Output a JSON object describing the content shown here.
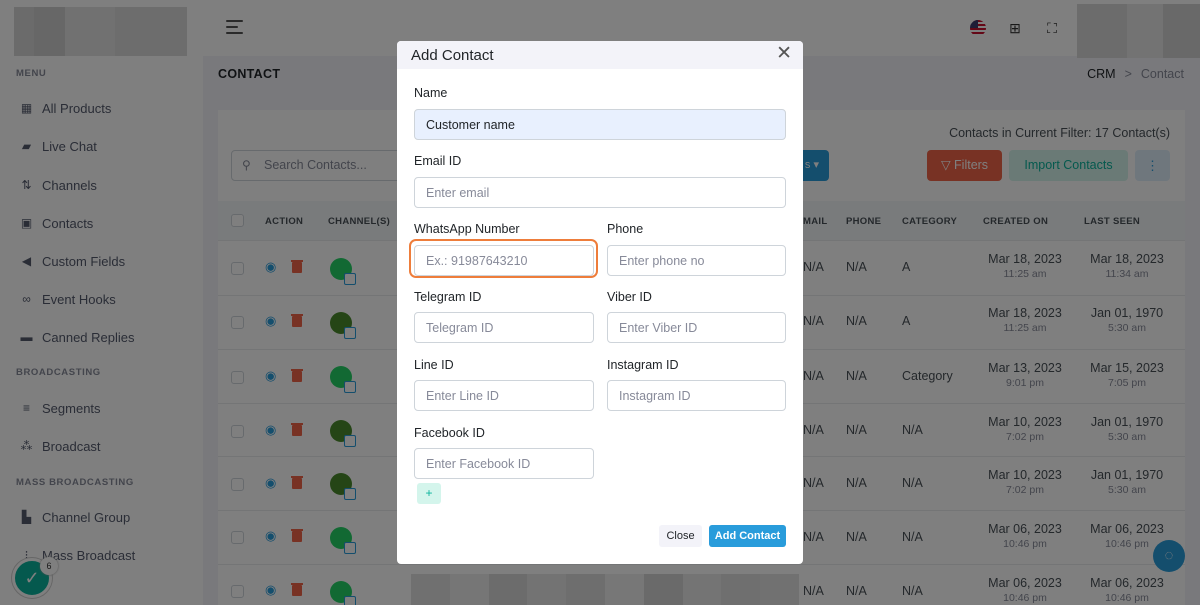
{
  "sidebar": {
    "menu_title": "MENU",
    "items": [
      {
        "label": "All Products",
        "icon": "grid-icon"
      },
      {
        "label": "Live Chat",
        "icon": "chat-icon"
      },
      {
        "label": "Channels",
        "icon": "channels-icon"
      },
      {
        "label": "Contacts",
        "icon": "contacts-icon"
      },
      {
        "label": "Custom Fields",
        "icon": "tag-icon"
      },
      {
        "label": "Event Hooks",
        "icon": "link-icon"
      },
      {
        "label": "Canned Replies",
        "icon": "message-icon"
      }
    ],
    "broadcasting_title": "BROADCASTING",
    "broadcasting_items": [
      {
        "label": "Segments",
        "icon": "segments-icon"
      },
      {
        "label": "Broadcast",
        "icon": "broadcast-icon"
      }
    ],
    "mass_title": "MASS BROADCASTING",
    "mass_items": [
      {
        "label": "Channel Group",
        "icon": "channel-group-icon"
      },
      {
        "label": "Mass Broadcast",
        "icon": "mass-broadcast-icon"
      }
    ]
  },
  "header": {
    "page_title": "CONTACT",
    "breadcrumb": {
      "root": "CRM",
      "sep": ">",
      "current": "Contact"
    }
  },
  "toolbar": {
    "search_placeholder": "Search Contacts...",
    "filter_count": "Contacts in Current Filter: 17 Contact(s)",
    "dropdown_suffix": "s",
    "filters_label": "Filters",
    "import_label": "Import Contacts",
    "more_label": "⋮"
  },
  "table": {
    "headers": {
      "action": "ACTION",
      "channels": "CHANNEL(S)",
      "email": "MAIL",
      "phone": "PHONE",
      "category": "CATEGORY",
      "created_on": "CREATED ON",
      "last_seen": "LAST SEEN"
    },
    "rows": [
      {
        "email": "N/A",
        "phone": "N/A",
        "category": "A",
        "created_date": "Mar 18, 2023",
        "created_time": "11:25 am",
        "seen_date": "Mar 18, 2023",
        "seen_time": "11:34 am"
      },
      {
        "email": "N/A",
        "phone": "N/A",
        "category": "A",
        "created_date": "Mar 18, 2023",
        "created_time": "11:25 am",
        "seen_date": "Jan 01, 1970",
        "seen_time": "5:30 am"
      },
      {
        "email": "N/A",
        "phone": "N/A",
        "category": "Category",
        "created_date": "Mar 13, 2023",
        "created_time": "9:01 pm",
        "seen_date": "Mar 15, 2023",
        "seen_time": "7:05 pm"
      },
      {
        "email": "N/A",
        "phone": "N/A",
        "category": "N/A",
        "created_date": "Mar 10, 2023",
        "created_time": "7:02 pm",
        "seen_date": "Jan 01, 1970",
        "seen_time": "5:30 am"
      },
      {
        "email": "N/A",
        "phone": "N/A",
        "category": "N/A",
        "created_date": "Mar 10, 2023",
        "created_time": "7:02 pm",
        "seen_date": "Jan 01, 1970",
        "seen_time": "5:30 am"
      },
      {
        "email": "N/A",
        "phone": "N/A",
        "category": "N/A",
        "created_date": "Mar 06, 2023",
        "created_time": "10:46 pm",
        "seen_date": "Mar 06, 2023",
        "seen_time": "10:46 pm"
      },
      {
        "email": "N/A",
        "phone": "N/A",
        "category": "N/A",
        "created_date": "Mar 06, 2023",
        "created_time": "10:46 pm",
        "seen_date": "Mar 06, 2023",
        "seen_time": "10:46 pm"
      }
    ]
  },
  "modal": {
    "title": "Add Contact",
    "name_label": "Name",
    "name_value": "Customer name",
    "email_label": "Email ID",
    "email_placeholder": "Enter email",
    "whatsapp_label": "WhatsApp Number",
    "whatsapp_placeholder": "Ex.: 91987643210",
    "phone_label": "Phone",
    "phone_placeholder": "Enter phone no",
    "telegram_label": "Telegram ID",
    "telegram_placeholder": "Telegram ID",
    "viber_label": "Viber ID",
    "viber_placeholder": "Enter Viber ID",
    "line_label": "Line ID",
    "line_placeholder": "Enter Line ID",
    "instagram_label": "Instagram ID",
    "instagram_placeholder": "Instagram ID",
    "facebook_label": "Facebook ID",
    "facebook_placeholder": "Enter Facebook ID",
    "add_field_label": "+",
    "close_label": "Close",
    "submit_label": "Add Contact"
  },
  "widgets": {
    "notification_count": "6",
    "check_glyph": "✓",
    "help_glyph": "◌"
  },
  "colors": {
    "primary": "#299cdb",
    "danger": "#f06548",
    "success": "#0ab39c",
    "whatsapp": "#25d366",
    "focus_highlight": "#ee7d3b"
  }
}
